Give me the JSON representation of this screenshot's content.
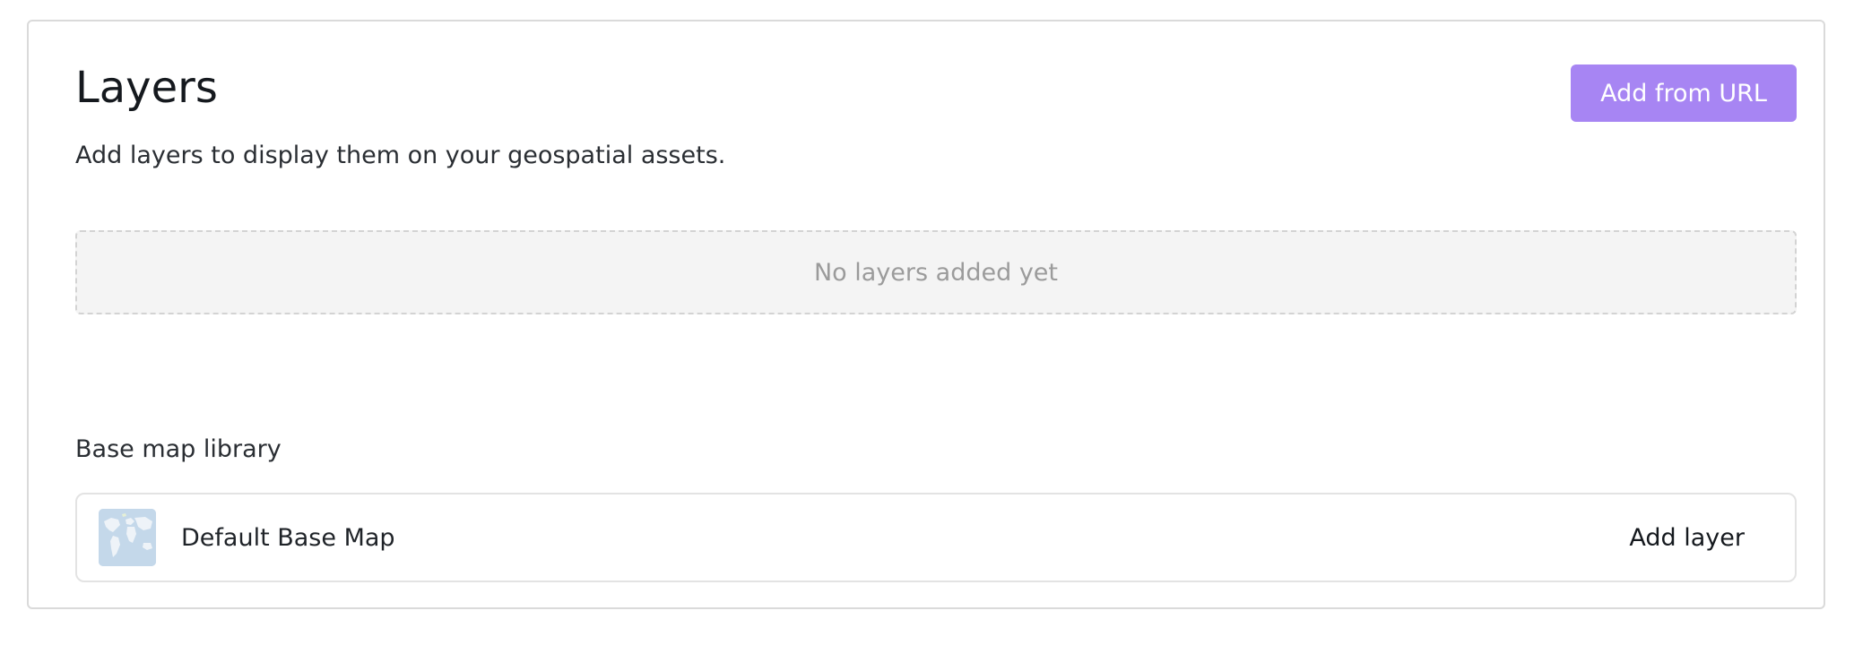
{
  "panel": {
    "title": "Layers",
    "subtitle": "Add layers to display them on your geospatial assets.",
    "add_from_url_label": "Add from URL"
  },
  "layers": {
    "empty_message": "No layers added yet"
  },
  "base_map_library": {
    "label": "Base map library",
    "items": [
      {
        "name": "Default Base Map",
        "action_label": "Add layer",
        "thumbnail_icon": "world-map-thumbnail"
      }
    ]
  },
  "colors": {
    "accent": "#a785f3",
    "empty_bg": "#f4f4f4",
    "border": "#dadada"
  }
}
